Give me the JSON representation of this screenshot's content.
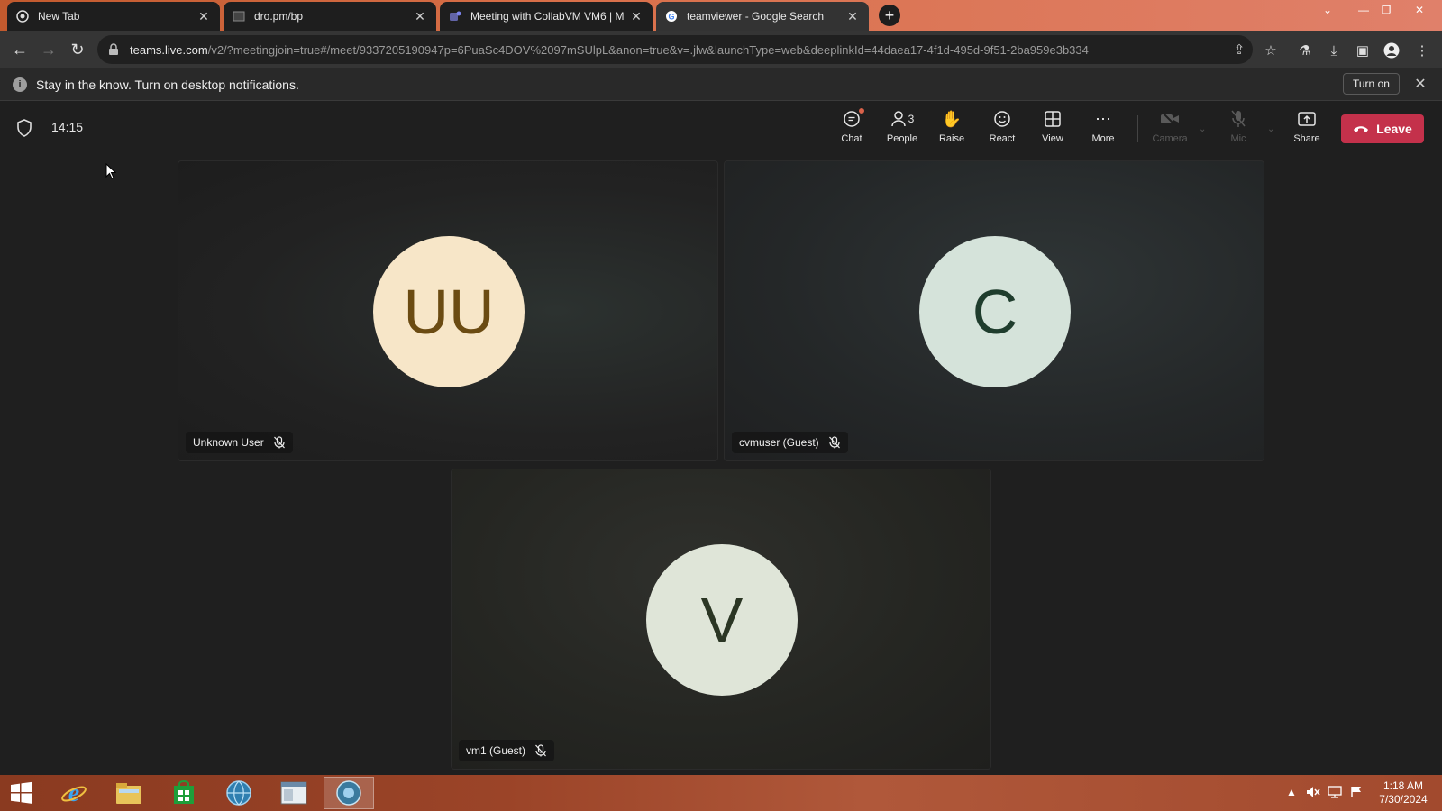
{
  "browser": {
    "tabs": [
      {
        "title": "New Tab",
        "icon": "chrome-icon"
      },
      {
        "title": "dro.pm/bp",
        "icon": "page-icon"
      },
      {
        "title": "Meeting with CollabVM VM6 | M",
        "icon": "teams-icon"
      },
      {
        "title": "teamviewer - Google Search",
        "icon": "google-icon"
      }
    ],
    "url_host": "teams.live.com",
    "url_rest": "/v2/?meetingjoin=true#/meet/9337205190947p=6PuaSc4DOV%2097mSUlpL&anon=true&v=.jlw&launchType=web&deeplinkId=44daea17-4f1d-495d-9f51-2ba959e3b334"
  },
  "notification": {
    "text": "Stay in the know. Turn on desktop notifications.",
    "button": "Turn on"
  },
  "meeting": {
    "timer": "14:15",
    "controls": {
      "chat": "Chat",
      "people": "People",
      "people_count": "3",
      "raise": "Raise",
      "react": "React",
      "view": "View",
      "more": "More",
      "camera": "Camera",
      "mic": "Mic",
      "share": "Share",
      "leave": "Leave"
    },
    "leave_color": "#c4314b",
    "participants": [
      {
        "initials": "UU",
        "name": "Unknown User",
        "muted": true
      },
      {
        "initials": "C",
        "name": "cvmuser (Guest)",
        "muted": true
      },
      {
        "initials": "V",
        "name": "vm1 (Guest)",
        "muted": true
      }
    ]
  },
  "taskbar": {
    "apps": [
      "start-icon",
      "internet-explorer-icon",
      "file-explorer-icon",
      "store-icon",
      "network-globe-icon",
      "window-icon",
      "chrome-globe-icon"
    ],
    "time": "1:18 AM",
    "date": "7/30/2024"
  }
}
